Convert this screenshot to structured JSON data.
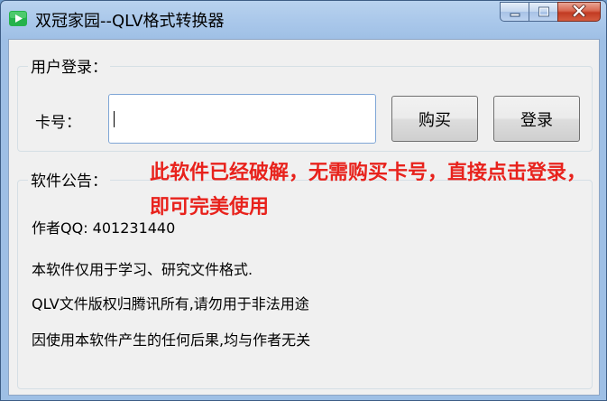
{
  "window": {
    "title": "双冠家园--QLV格式转换器",
    "app_icon": "app-logo-icon",
    "controls": {
      "minimize_icon": "minimize-icon",
      "maximize_icon": "maximize-icon",
      "close_icon": "close-icon"
    }
  },
  "login": {
    "group_label": "用户登录：",
    "card_label": "卡号：",
    "card_value": "",
    "buy_label": "购买",
    "login_label": "登录"
  },
  "notice": {
    "group_label": "软件公告：",
    "author_line": "作者QQ: 401231440",
    "lines": [
      "本软件仅用于学习、研究文件格式.",
      "QLV文件版权归腾讯所有,请勿用于非法用途",
      "因使用本软件产生的任何后果,均与作者无关"
    ]
  },
  "annotation": {
    "text": "此软件已经破解，无需购买卡号，直接点击登录，即可完美使用",
    "color": "#e8221c"
  },
  "colors": {
    "titlebar": "#a9c7ea",
    "close_button": "#c23b22",
    "input_border": "#7fa6d6"
  }
}
